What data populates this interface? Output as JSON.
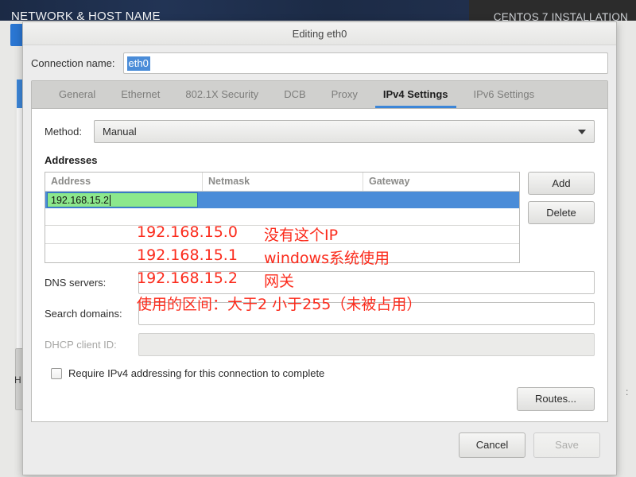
{
  "background": {
    "header_title": "NETWORK & HOST NAME",
    "header_subtitle": "CENTOS 7 INSTALLATION",
    "bottom_label": "H",
    "right_marker": ":"
  },
  "dialog": {
    "title": "Editing eth0",
    "connection": {
      "label": "Connection name:",
      "value": "eth0"
    },
    "tabs": [
      {
        "label": "General",
        "active": false
      },
      {
        "label": "Ethernet",
        "active": false
      },
      {
        "label": "802.1X Security",
        "active": false
      },
      {
        "label": "DCB",
        "active": false
      },
      {
        "label": "Proxy",
        "active": false
      },
      {
        "label": "IPv4 Settings",
        "active": true
      },
      {
        "label": "IPv6 Settings",
        "active": false
      }
    ],
    "method": {
      "label": "Method:",
      "value": "Manual",
      "caret_icon": "chevron-down-icon"
    },
    "addresses": {
      "section_label": "Addresses",
      "columns": [
        "Address",
        "Netmask",
        "Gateway"
      ],
      "rows": [
        {
          "address": "192.168.15.2",
          "netmask": "",
          "gateway": "",
          "editing": true
        }
      ],
      "add_label": "Add",
      "delete_label": "Delete"
    },
    "fields": {
      "dns_label": "DNS servers:",
      "dns_value": "",
      "search_label": "Search domains:",
      "search_value": "",
      "dhcp_label": "DHCP client ID:",
      "dhcp_value": "",
      "dhcp_disabled": true
    },
    "require_ipv4": {
      "label": "Require IPv4 addressing for this connection to complete",
      "checked": false
    },
    "routes_label": "Routes...",
    "cancel_label": "Cancel",
    "save_label": "Save",
    "save_disabled": true
  },
  "annotations": [
    {
      "text": "192.168.15.0",
      "note": "没有这个IP"
    },
    {
      "text": "192.168.15.1",
      "note": "windows系统使用"
    },
    {
      "text": "192.168.15.2",
      "note": "网关"
    },
    {
      "text": "使用的区间：大于2  小于255（未被占用）",
      "note": ""
    }
  ],
  "colors": {
    "accent_blue": "#4a8cd8",
    "selection_green": "#8ce88c",
    "annotation_red": "#fb2b1c",
    "header_navy": "#1f2d4a",
    "header_dark": "#2c2c2c"
  }
}
